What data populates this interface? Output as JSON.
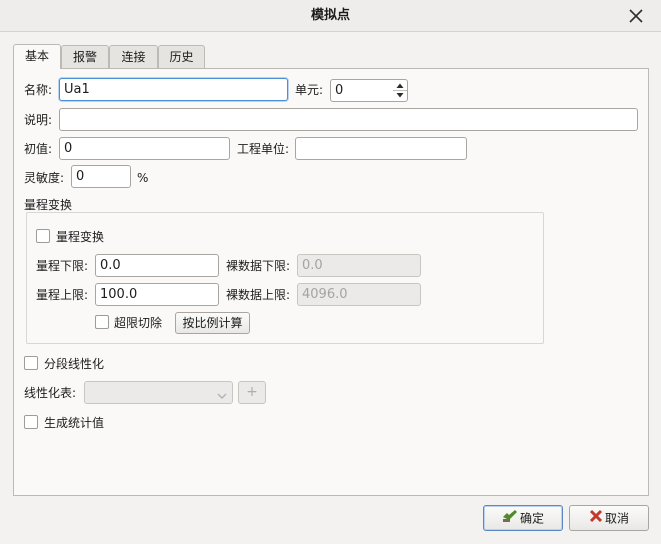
{
  "window": {
    "title": "模拟点"
  },
  "tabs": [
    {
      "label": "基本",
      "active": true
    },
    {
      "label": "报警",
      "active": false
    },
    {
      "label": "连接",
      "active": false
    },
    {
      "label": "历史",
      "active": false
    }
  ],
  "basic": {
    "name_label": "名称:",
    "name_value": "Ua1",
    "unit_label": "单元:",
    "unit_value": "0",
    "desc_label": "说明:",
    "desc_value": "",
    "init_label": "初值:",
    "init_value": "0",
    "eng_unit_label": "工程单位:",
    "eng_unit_value": "",
    "sensitivity_label": "灵敏度:",
    "sensitivity_value": "0",
    "sensitivity_unit": "%"
  },
  "range": {
    "group_title": "量程变换",
    "enable_label": "量程变换",
    "low_label": "量程下限:",
    "low_value": "0.0",
    "raw_low_label": "裸数据下限:",
    "raw_low_value": "0.0",
    "high_label": "量程上限:",
    "high_value": "100.0",
    "raw_high_label": "裸数据上限:",
    "raw_high_value": "4096.0",
    "clip_label": "超限切除",
    "calc_button": "按比例计算"
  },
  "linearize": {
    "enable_label": "分段线性化",
    "table_label": "线性化表:",
    "table_value": "",
    "add_button": "+"
  },
  "stats": {
    "enable_label": "生成统计值"
  },
  "footer": {
    "ok_label": "确定",
    "cancel_label": "取消"
  },
  "colors": {
    "focus_border": "#4a90d9",
    "ok_icon": "#4f8a2c",
    "cancel_icon": "#c0392b"
  }
}
